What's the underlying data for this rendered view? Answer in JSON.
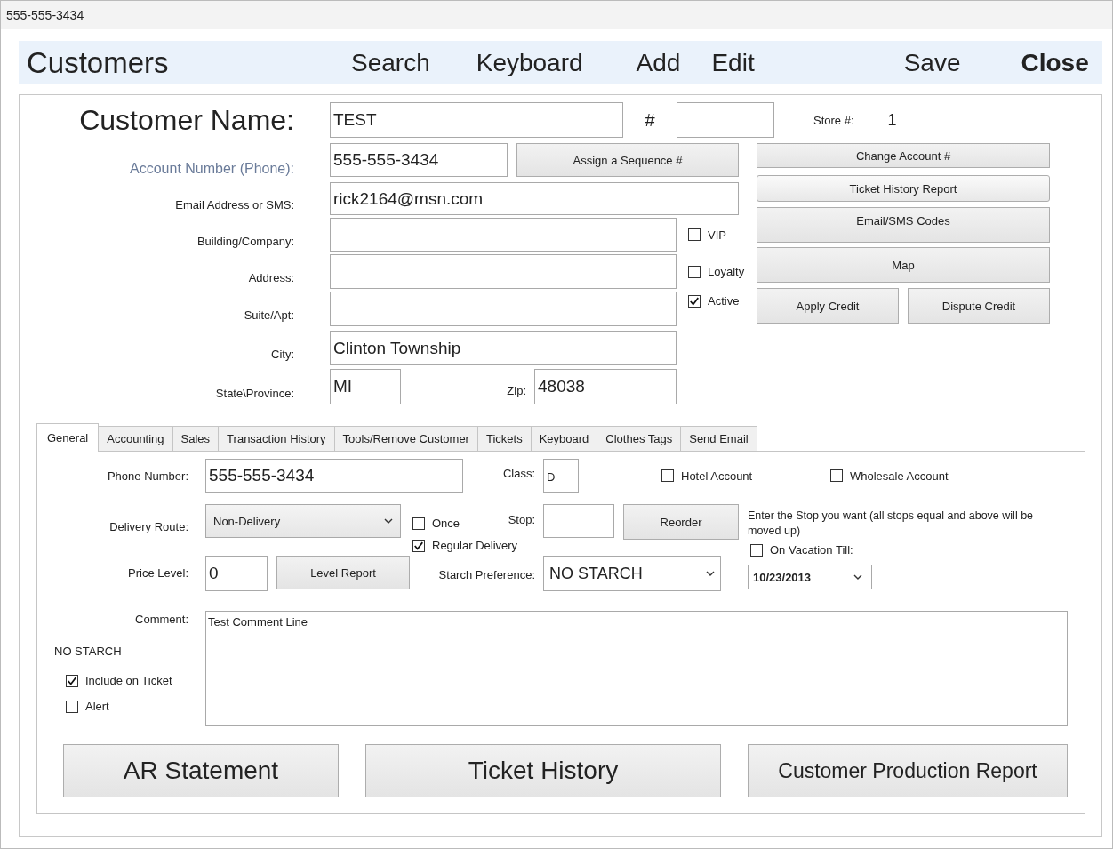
{
  "window": {
    "title": "555-555-3434"
  },
  "header": {
    "title": "Customers",
    "actions": [
      {
        "label": "Search",
        "emphasized": false
      },
      {
        "label": "Keyboard",
        "emphasized": false
      },
      {
        "label": "Add",
        "emphasized": false
      },
      {
        "label": "Edit",
        "emphasized": false
      },
      {
        "label": "Save",
        "emphasized": false
      },
      {
        "label": "Close",
        "emphasized": true
      }
    ]
  },
  "customer": {
    "name_label": "Customer Name:",
    "name": "TEST",
    "number_label": "#",
    "store_label": "Store #:",
    "store": "1"
  },
  "account": {
    "label": "Account Number (Phone):",
    "value": "555-555-3434",
    "button": "Assign a Sequence #"
  },
  "email": {
    "label": "Email Address or SMS:",
    "value": "rick2164@msn.com"
  },
  "building": {
    "label": "Building/Company:"
  },
  "address": {
    "label": "Address:"
  },
  "suite": {
    "label": "Suite/Apt:"
  },
  "city": {
    "label": "City:",
    "value": "Clinton Township"
  },
  "state": {
    "label": "State\\Province:",
    "value": "MI"
  },
  "zip": {
    "label": "Zip:",
    "value": "48038"
  },
  "flags": [
    {
      "label": "VIP",
      "checked": false
    },
    {
      "label": "Loyalty",
      "checked": false
    },
    {
      "label": "Active",
      "checked": true
    }
  ],
  "side_buttons": [
    "Change Account #",
    "Ticket History Report",
    "Email/SMS Codes",
    "Map"
  ],
  "credit_buttons": [
    "Apply Credit",
    "Dispute Credit"
  ],
  "tabs": [
    {
      "label": "General",
      "selected": true
    },
    {
      "label": "Accounting",
      "selected": false
    },
    {
      "label": "Sales",
      "selected": false
    },
    {
      "label": "Transaction History",
      "selected": false
    },
    {
      "label": "Tools/Remove Customer",
      "selected": false
    },
    {
      "label": "Tickets",
      "selected": false
    },
    {
      "label": "Keyboard",
      "selected": false
    },
    {
      "label": "Clothes Tags",
      "selected": false
    },
    {
      "label": "Send Email",
      "selected": false
    }
  ],
  "general": {
    "phone": {
      "label": "Phone Number:",
      "value": "555-555-3434"
    },
    "class": {
      "label": "Class:",
      "value": "D"
    },
    "hotel": {
      "label": "Hotel Account",
      "checked": false
    },
    "wholesale": {
      "label": "Wholesale Account",
      "checked": false
    },
    "route": {
      "label": "Delivery Route:",
      "value": "Non-Delivery"
    },
    "once": {
      "label": "Once",
      "checked": false
    },
    "regular": {
      "label": "Regular Delivery",
      "checked": true
    },
    "stop": {
      "label": "Stop:"
    },
    "reorder": "Reorder",
    "stop_note": "Enter the Stop you want (all stops equal and above will be moved up)",
    "vacation": {
      "label": "On Vacation Till:",
      "checked": false
    },
    "vacation_date": "10/23/2013",
    "price": {
      "label": "Price Level:",
      "value": "0"
    },
    "level_report": "Level Report",
    "starch": {
      "label": "Starch Preference:",
      "value": "NO STARCH"
    },
    "comment": {
      "label": "Comment:",
      "value": "Test Comment Line"
    },
    "starch_note": "NO STARCH",
    "include": {
      "label": "Include on Ticket",
      "checked": true
    },
    "alert": {
      "label": "Alert",
      "checked": false
    },
    "bottom_buttons": [
      "AR Statement",
      "Ticket History",
      "Customer Production Report"
    ]
  }
}
